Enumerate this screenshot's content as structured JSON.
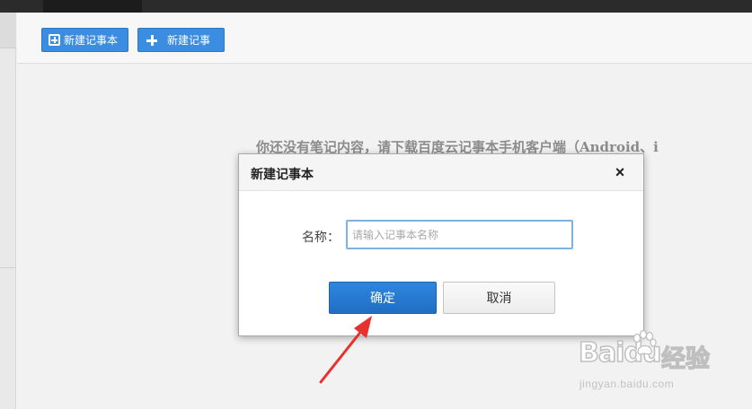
{
  "toolbar": {
    "new_notebook_label": "新建记事本",
    "new_note_label": "新建记事"
  },
  "main": {
    "empty_message": "你还没有笔记内容，请下载百度云记事本手机客户端（Android、i"
  },
  "dialog": {
    "title": "新建记事本",
    "close_symbol": "×",
    "name_label": "名称：",
    "name_value": "",
    "name_placeholder": "请输入记事本名称",
    "confirm_label": "确定",
    "cancel_label": "取消"
  },
  "watermark": {
    "logo_text": "Baidu",
    "product_text": "经验",
    "url": "jingyan.baidu.com"
  },
  "colors": {
    "primary_button": "#3a8de0",
    "annotation_arrow": "#e8312c"
  }
}
